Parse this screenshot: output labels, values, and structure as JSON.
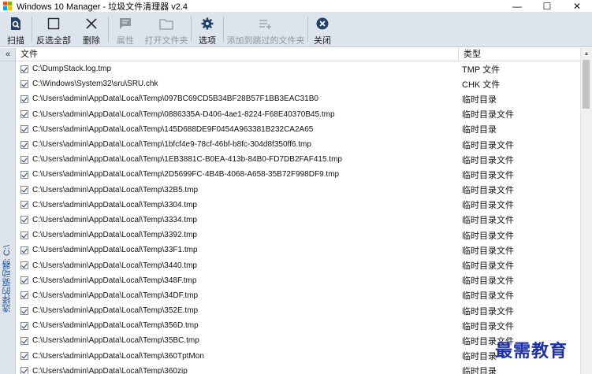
{
  "window": {
    "title": "Windows 10 Manager - 垃圾文件清理器 v2.4",
    "minimize": "—",
    "maximize": "☐",
    "close": "✕"
  },
  "toolbar": {
    "scan": "扫描",
    "invert_all": "反选全部",
    "delete": "删除",
    "properties": "属性",
    "open_folder": "打开文件夹",
    "options": "选项",
    "add_to_skip": "添加到跳过的文件夹",
    "close": "关闭"
  },
  "left_panel": {
    "collapse": "«",
    "drive_label": "选择的驱动器: C:\\"
  },
  "list": {
    "columns": {
      "file": "文件",
      "type": "类型"
    },
    "rows": [
      {
        "path": "C:\\DumpStack.log.tmp",
        "type": "TMP 文件"
      },
      {
        "path": "C:\\Windows\\System32\\sru\\SRU.chk",
        "type": "CHK 文件"
      },
      {
        "path": "C:\\Users\\admin\\AppData\\Local\\Temp\\097BC69CD5B34BF28B57F1BB3EAC31B0",
        "type": "临时目录"
      },
      {
        "path": "C:\\Users\\admin\\AppData\\Local\\Temp\\0886335A-D406-4ae1-8224-F68E40370B45.tmp",
        "type": "临时目录文件"
      },
      {
        "path": "C:\\Users\\admin\\AppData\\Local\\Temp\\145D688DE9F0454A963381B232CA2A65",
        "type": "临时目录"
      },
      {
        "path": "C:\\Users\\admin\\AppData\\Local\\Temp\\1bfcf4e9-78cf-46bf-b8fc-304d8f350ff6.tmp",
        "type": "临时目录文件"
      },
      {
        "path": "C:\\Users\\admin\\AppData\\Local\\Temp\\1EB3881C-B0EA-413b-84B0-FD7DB2FAF415.tmp",
        "type": "临时目录文件"
      },
      {
        "path": "C:\\Users\\admin\\AppData\\Local\\Temp\\2D5699FC-4B4B-4068-A658-35B72F998DF9.tmp",
        "type": "临时目录文件"
      },
      {
        "path": "C:\\Users\\admin\\AppData\\Local\\Temp\\32B5.tmp",
        "type": "临时目录文件"
      },
      {
        "path": "C:\\Users\\admin\\AppData\\Local\\Temp\\3304.tmp",
        "type": "临时目录文件"
      },
      {
        "path": "C:\\Users\\admin\\AppData\\Local\\Temp\\3334.tmp",
        "type": "临时目录文件"
      },
      {
        "path": "C:\\Users\\admin\\AppData\\Local\\Temp\\3392.tmp",
        "type": "临时目录文件"
      },
      {
        "path": "C:\\Users\\admin\\AppData\\Local\\Temp\\33F1.tmp",
        "type": "临时目录文件"
      },
      {
        "path": "C:\\Users\\admin\\AppData\\Local\\Temp\\3440.tmp",
        "type": "临时目录文件"
      },
      {
        "path": "C:\\Users\\admin\\AppData\\Local\\Temp\\348F.tmp",
        "type": "临时目录文件"
      },
      {
        "path": "C:\\Users\\admin\\AppData\\Local\\Temp\\34DF.tmp",
        "type": "临时目录文件"
      },
      {
        "path": "C:\\Users\\admin\\AppData\\Local\\Temp\\352E.tmp",
        "type": "临时目录文件"
      },
      {
        "path": "C:\\Users\\admin\\AppData\\Local\\Temp\\356D.tmp",
        "type": "临时目录文件"
      },
      {
        "path": "C:\\Users\\admin\\AppData\\Local\\Temp\\35BC.tmp",
        "type": "临时目录文件"
      },
      {
        "path": "C:\\Users\\admin\\AppData\\Local\\Temp\\360TptMon",
        "type": "临时目录"
      },
      {
        "path": "C:\\Users\\admin\\AppData\\Local\\Temp\\360zip",
        "type": "临时目录"
      }
    ]
  },
  "scrollbar": {
    "up": "▲",
    "down": "▼"
  },
  "watermark": "最需教育",
  "colors": {
    "toolbar_bg": "#dde4ec",
    "drive_label": "#1f4f9c",
    "watermark": "#1c2fa8",
    "accent_icon": "#24416b"
  }
}
